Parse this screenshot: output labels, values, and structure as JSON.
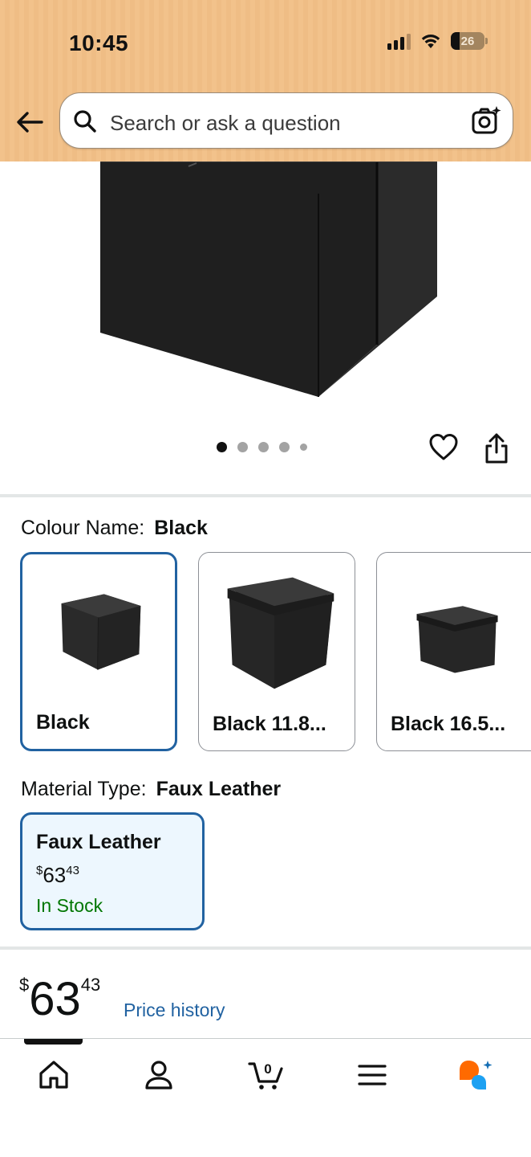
{
  "status_bar": {
    "time": "10:45",
    "battery": "26"
  },
  "header": {
    "search_placeholder": "Search or ask a question"
  },
  "gallery": {
    "dot_count": 5,
    "active_index": 0
  },
  "colour": {
    "label": "Colour Name:",
    "selected": "Black",
    "options": [
      {
        "label": "Black",
        "selected": true
      },
      {
        "label": "Black 11.8...",
        "selected": false
      },
      {
        "label": "Black 16.5...",
        "selected": false
      }
    ]
  },
  "material": {
    "label": "Material Type:",
    "selected": "Faux Leather",
    "option": {
      "name": "Faux Leather",
      "price_symbol": "$",
      "price_whole": "63",
      "price_fraction": "43",
      "stock": "In Stock"
    }
  },
  "price": {
    "symbol": "$",
    "whole": "63",
    "fraction": "43",
    "history_link": "Price history"
  },
  "bottom_nav": {
    "items": [
      "home-icon",
      "account-icon",
      "cart-icon",
      "menu-icon",
      "rufus-ai-icon"
    ],
    "cart_count": "0",
    "active_index": 0
  },
  "colors": {
    "accent": "#2162a1",
    "header": "#f2c28b",
    "stock": "#007600",
    "selected_bg": "#edf7fe"
  }
}
